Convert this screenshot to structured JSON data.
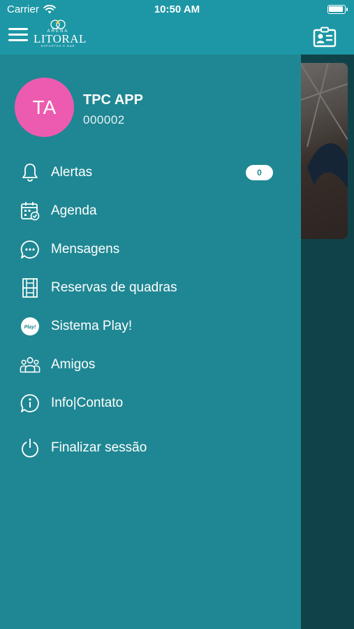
{
  "status_bar": {
    "carrier": "Carrier",
    "time": "10:50 AM"
  },
  "header": {
    "logo": {
      "top": "ARENA",
      "main": "LITORAL",
      "sub": "ESPORTES E BAR"
    }
  },
  "user": {
    "initials": "TA",
    "name": "TPC APP",
    "code": "000002"
  },
  "menu": {
    "items": [
      {
        "label": "Alertas",
        "icon": "bell-icon",
        "badge": "0"
      },
      {
        "label": "Agenda",
        "icon": "calendar-check-icon"
      },
      {
        "label": "Mensagens",
        "icon": "chat-bubble-icon"
      },
      {
        "label": "Reservas de quadras",
        "icon": "court-icon"
      },
      {
        "label": "Sistema Play!",
        "icon": "play-logo-icon",
        "icon_text": "Play!"
      },
      {
        "label": "Amigos",
        "icon": "friends-icon"
      },
      {
        "label": "Info|Contato",
        "icon": "info-bubble-icon"
      },
      {
        "label": "Finalizar sessão",
        "icon": "power-icon"
      }
    ]
  },
  "colors": {
    "drawer": "#1f8793",
    "header": "#1d97a5",
    "avatar": "#ec5bb0"
  }
}
